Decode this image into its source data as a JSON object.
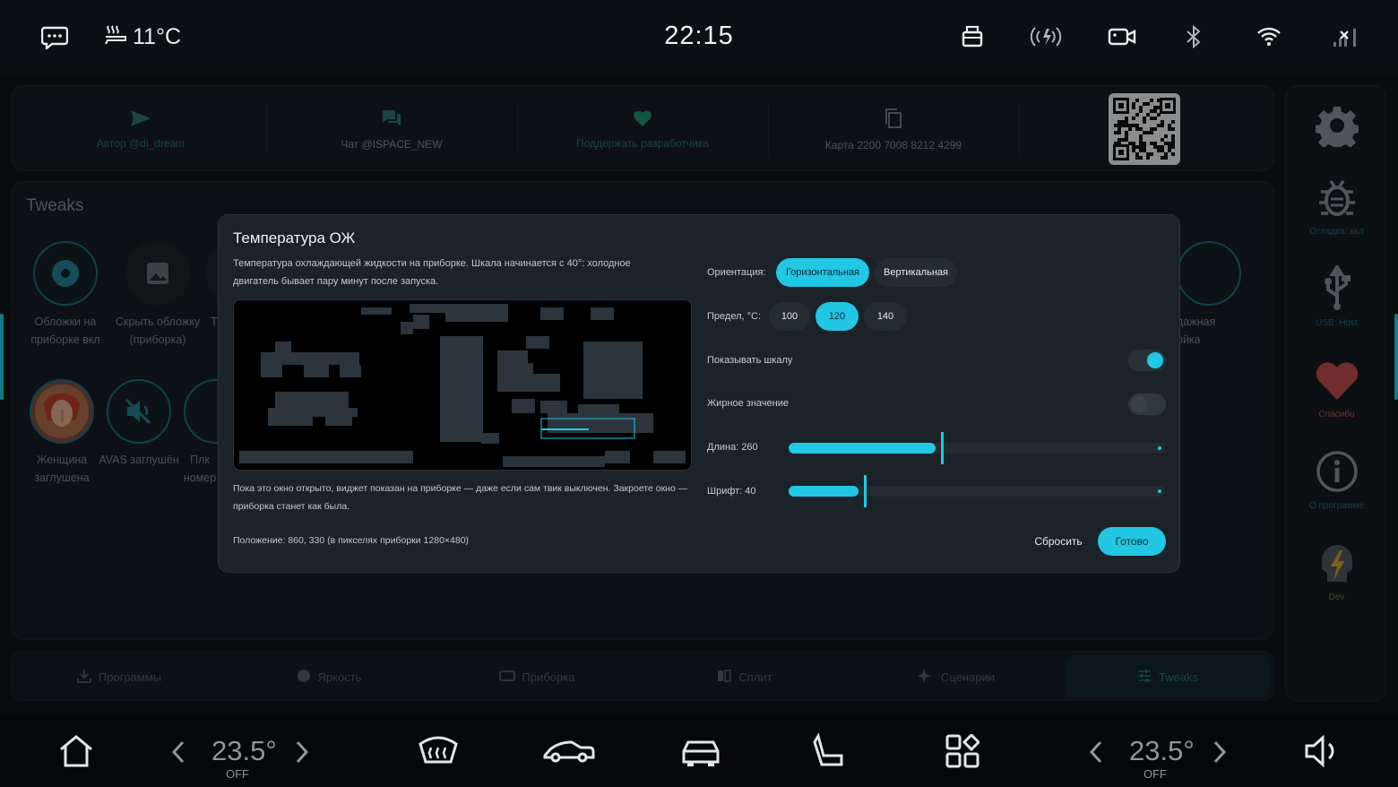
{
  "status": {
    "time": "22:15",
    "outside_temp": "11°C",
    "icons": [
      "chat-icon",
      "seat-heat-icon",
      "usb-drive-icon",
      "wireless-charge-icon",
      "camera-icon",
      "bluetooth-icon",
      "wifi-icon",
      "signal-off-icon"
    ]
  },
  "links": [
    {
      "label": "Автор @di_dream",
      "icon": "send-icon"
    },
    {
      "label": "Чат @ISPACE_NEW",
      "icon": "forum-icon"
    },
    {
      "label": "Поддержать разработчика",
      "icon": "heart-icon"
    },
    {
      "label": "Карта 2200 7008 8212 4299",
      "icon": "copy-icon"
    }
  ],
  "tweaks": {
    "title": "Tweaks",
    "tiles": [
      {
        "label": "Обложки на приборке вкл"
      },
      {
        "label": "Скрыть обложку (приборка)"
      },
      {
        "label": "Т"
      },
      {
        "label": "Женщина заглушена"
      },
      {
        "label": "AVAS заглушён"
      },
      {
        "label": "Плк номер"
      },
      {
        "label": "дажная ойка"
      }
    ]
  },
  "tabs": [
    {
      "label": "Программы",
      "icon": "download-icon"
    },
    {
      "label": "Яркость",
      "icon": "brightness-icon"
    },
    {
      "label": "Приборка",
      "icon": "dashboard-icon"
    },
    {
      "label": "Сплит",
      "icon": "split-icon"
    },
    {
      "label": "Сценарии",
      "icon": "sparkle-icon"
    },
    {
      "label": "Tweaks",
      "icon": "tune-icon",
      "active": true
    }
  ],
  "sidebar": [
    {
      "label": "",
      "icon": "gear-icon"
    },
    {
      "label": "Отладка: вкл",
      "icon": "bug-icon"
    },
    {
      "label": "USB: Host",
      "icon": "usb-icon"
    },
    {
      "label": "Спасибо",
      "icon": "heart-icon"
    },
    {
      "label": "О программе",
      "icon": "info-icon"
    },
    {
      "label": "Dev",
      "icon": "dev-icon"
    }
  ],
  "climate": {
    "left": {
      "temp": "23.5°",
      "state": "OFF"
    },
    "right": {
      "temp": "23.5°",
      "state": "OFF"
    }
  },
  "dialog": {
    "title": "Температура ОЖ",
    "description": "Температура охлаждающей жидкости на приборке. Шкала начинается с 40°: холодное двигатель бывает пару минут после запуска.",
    "note": "Пока это окно открыто, виджет показан на приборке — даже если сам твик выключен. Закроете окно — приборка станет как была.",
    "position": "Положение: 860, 330 (в пикселях приборки 1280×480)",
    "orientation_label": "Ориентация:",
    "orientation_options": [
      "Горизонтальная",
      "Вертикальная"
    ],
    "orientation_selected": "Горизонтальная",
    "limit_label": "Предел, °C:",
    "limit_options": [
      "100",
      "120",
      "140"
    ],
    "limit_selected": "120",
    "show_scale_label": "Показывать шкалу",
    "show_scale": true,
    "bold_value_label": "Жирное значение",
    "bold_value": false,
    "length_label": "Длина: 260",
    "length_fraction": 0.405,
    "font_label": "Шрифт: 40",
    "font_fraction": 0.2,
    "reset_label": "Сбросить",
    "done_label": "Готово"
  },
  "colors": {
    "accent": "#22c7e3",
    "heart": "#b84a4a",
    "link": "#2d6f73"
  }
}
